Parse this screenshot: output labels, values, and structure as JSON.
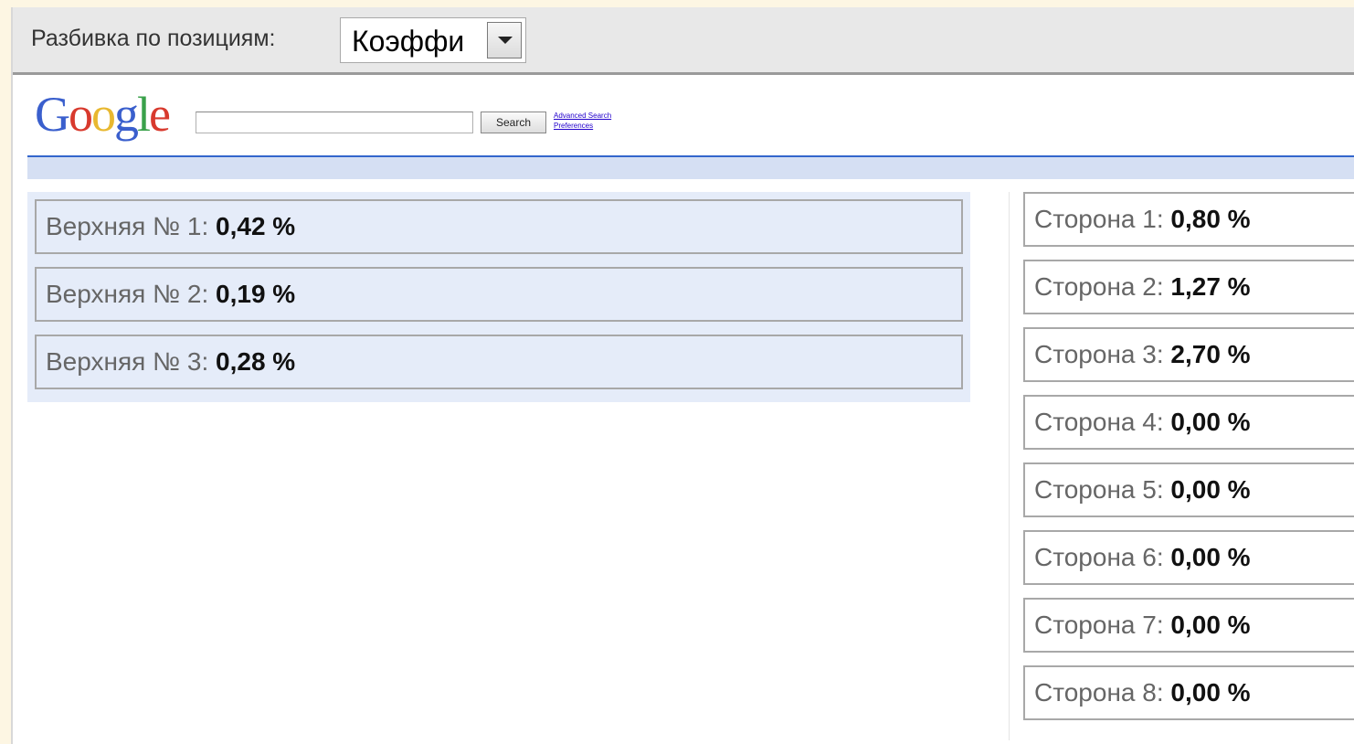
{
  "toolbar": {
    "label": "Разбивка по позициям:",
    "select_value": "Коэффи"
  },
  "google": {
    "logo_letters": [
      {
        "ch": "G",
        "color": "#3a5fcd"
      },
      {
        "ch": "o",
        "color": "#d83a2e"
      },
      {
        "ch": "o",
        "color": "#e8b830"
      },
      {
        "ch": "g",
        "color": "#3a5fcd"
      },
      {
        "ch": "l",
        "color": "#3aa14a"
      },
      {
        "ch": "e",
        "color": "#d83a2e"
      }
    ],
    "search_button": "Search",
    "link_advanced": "Advanced Search",
    "link_preferences": "Preferences"
  },
  "top_positions": [
    {
      "label": "Верхняя № 1:",
      "value": "0,42 %"
    },
    {
      "label": "Верхняя № 2:",
      "value": "0,19 %"
    },
    {
      "label": "Верхняя № 3:",
      "value": "0,28 %"
    }
  ],
  "side_positions": [
    {
      "label": "Сторона 1:",
      "value": "0,80 %"
    },
    {
      "label": "Сторона 2:",
      "value": "1,27 %"
    },
    {
      "label": "Сторона 3:",
      "value": "2,70 %"
    },
    {
      "label": "Сторона 4:",
      "value": "0,00 %"
    },
    {
      "label": "Сторона 5:",
      "value": "0,00 %"
    },
    {
      "label": "Сторона 6:",
      "value": "0,00 %"
    },
    {
      "label": "Сторона 7:",
      "value": "0,00 %"
    },
    {
      "label": "Сторона 8:",
      "value": "0,00 %"
    }
  ]
}
